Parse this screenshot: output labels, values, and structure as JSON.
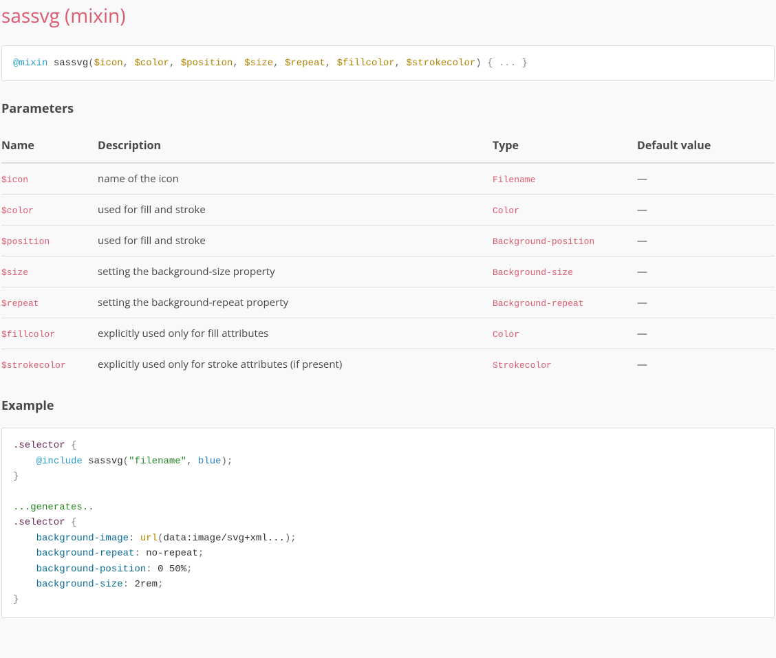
{
  "title": "sassvg (mixin)",
  "signature": {
    "keyword": "@mixin",
    "name": "sassvg",
    "params": [
      "$icon",
      "$color",
      "$position",
      "$size",
      "$repeat",
      "$fillcolor",
      "$strokecolor"
    ],
    "body_placeholder": "..."
  },
  "sections": {
    "parameters_heading": "Parameters",
    "example_heading": "Example"
  },
  "table": {
    "headers": {
      "name": "Name",
      "description": "Description",
      "type": "Type",
      "default": "Default value"
    },
    "dash": "—",
    "rows": [
      {
        "name": "$icon",
        "description": "name of the icon",
        "type": "Filename",
        "default": "—"
      },
      {
        "name": "$color",
        "description": "used for fill and stroke",
        "type": "Color",
        "default": "—"
      },
      {
        "name": "$position",
        "description": "used for fill and stroke",
        "type": "Background-position",
        "default": "—"
      },
      {
        "name": "$size",
        "description": "setting the background-size property",
        "type": "Background-size",
        "default": "—"
      },
      {
        "name": "$repeat",
        "description": "setting the background-repeat property",
        "type": "Background-repeat",
        "default": "—"
      },
      {
        "name": "$fillcolor",
        "description": "explicitly used only for fill attributes",
        "type": "Color",
        "default": "—"
      },
      {
        "name": "$strokecolor",
        "description": "explicitly used only for stroke attributes (if present)",
        "type": "Strokecolor",
        "default": "—"
      }
    ]
  },
  "example": {
    "line1_sel": ".selector",
    "line2_at": "@include",
    "line2_name": "sassvg",
    "line2_str": "\"filename\"",
    "line2_val": "blue",
    "comment": "...generates..",
    "out_sel": ".selector",
    "out_p1": "background-image",
    "out_p1_func": "url",
    "out_p1_arg": "data:image/svg+xml...",
    "out_p2": "background-repeat",
    "out_p2_val": "no-repeat",
    "out_p3": "background-position",
    "out_p3_val": "0 50%",
    "out_p4": "background-size",
    "out_p4_val": "2rem"
  }
}
